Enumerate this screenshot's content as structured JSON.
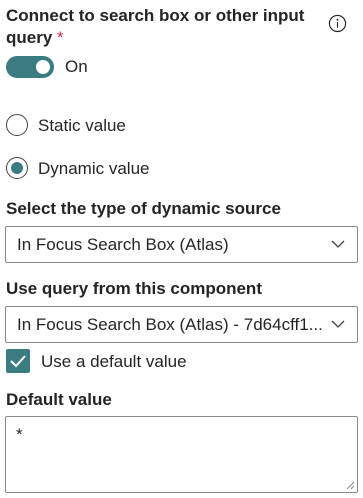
{
  "connect": {
    "title_line1": "Connect to search box or other input",
    "title_line2": "query",
    "required_mark": "*",
    "info_icon": "info-icon",
    "toggle_state_label": "On",
    "toggle_on": true
  },
  "value_type": {
    "options": [
      {
        "label": "Static value",
        "selected": false
      },
      {
        "label": "Dynamic value",
        "selected": true
      }
    ]
  },
  "source_type": {
    "label": "Select the type of dynamic source",
    "selected": "In Focus Search Box (Atlas)"
  },
  "query_component": {
    "label": "Use query from this component",
    "selected": "In Focus Search Box (Atlas) - 7d64cff1..."
  },
  "default_toggle": {
    "label": "Use a default value",
    "checked": true
  },
  "default_value": {
    "label": "Default value",
    "value": "*"
  },
  "colors": {
    "accent": "#3a7c82",
    "required": "#c4314b",
    "border": "#8a8a8a",
    "text": "#242424"
  }
}
